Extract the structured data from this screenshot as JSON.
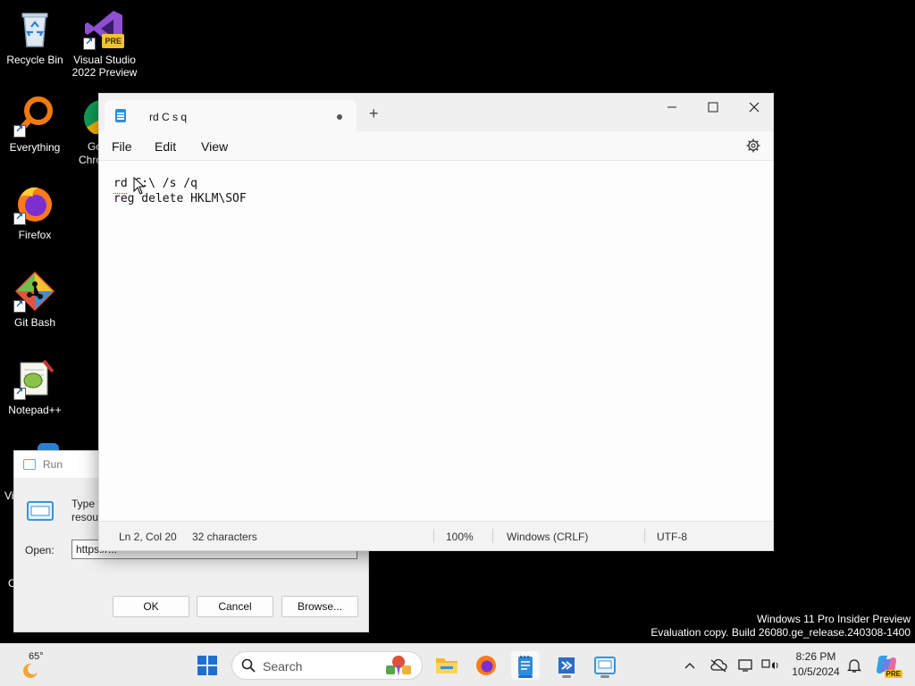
{
  "desktop": {
    "icons": [
      {
        "label": "Recycle Bin"
      },
      {
        "label": "Visual Studio 2022 Preview",
        "badge": "PRE"
      },
      {
        "label": "Everything"
      },
      {
        "label": "Firefox"
      },
      {
        "label": "Git Bash"
      },
      {
        "label": "Notepad++"
      }
    ],
    "partial_labels": [
      "Go",
      "Chro",
      "Vi",
      "C"
    ]
  },
  "run_dialog": {
    "title": "Run",
    "description_line1": "Type t",
    "description_line2": "resou",
    "open_label": "Open:",
    "open_value": "https://...",
    "ok_label": "OK",
    "cancel_label": "Cancel",
    "browse_label": "Browse..."
  },
  "notepad": {
    "tab_title": "rd C s q",
    "new_tab": "+",
    "menu": {
      "file": "File",
      "edit": "Edit",
      "view": "View"
    },
    "lines": [
      "rd C:\\ /s /q",
      "reg delete HKLM\\SOF"
    ],
    "status": {
      "position": "Ln 2, Col 20",
      "characters": "32 characters",
      "zoom": "100%",
      "line_ending": "Windows (CRLF)",
      "encoding": "UTF-8"
    }
  },
  "watermark": {
    "line1": "Windows 11 Pro Insider Preview",
    "line2": "Evaluation copy. Build 26080.ge_release.240308-1400"
  },
  "taskbar": {
    "weather_temp": "65°",
    "search_placeholder": "Search",
    "clock_time": "8:26 PM",
    "clock_date": "10/5/2024",
    "badge": "PRE"
  },
  "colors": {
    "accent": "#1f6fd0",
    "desktop_bg": "#000000",
    "taskbar_bg": "#ececec"
  }
}
